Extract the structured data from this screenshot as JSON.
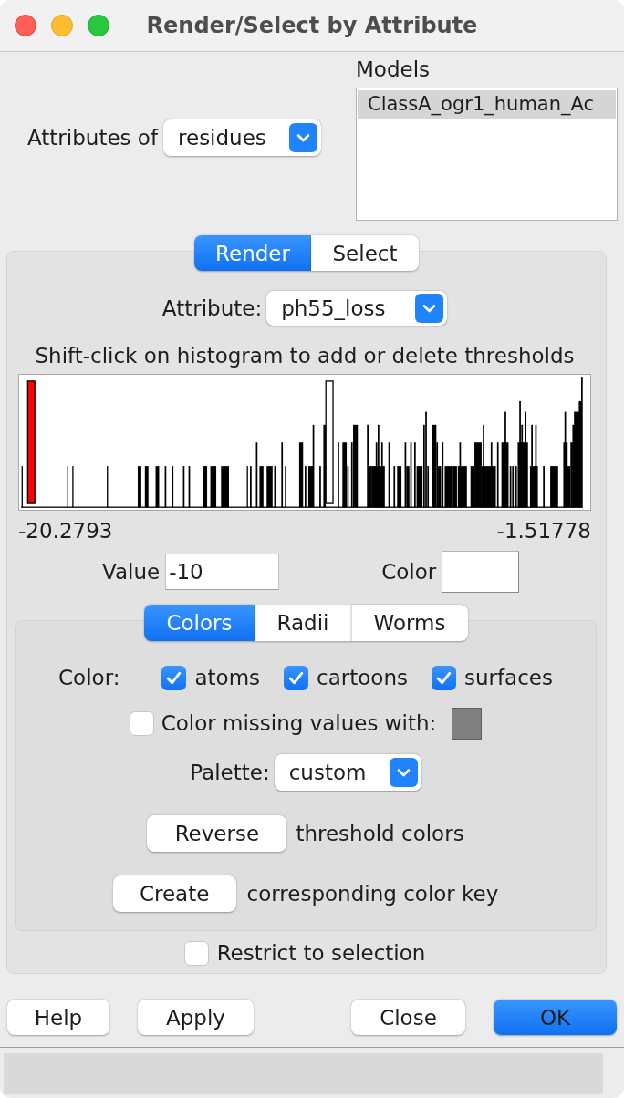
{
  "window": {
    "title": "Render/Select by Attribute"
  },
  "attributes_of": {
    "label": "Attributes of",
    "value": "residues"
  },
  "models": {
    "label": "Models",
    "items": [
      {
        "label": "ClassA_ogr1_human_Ac",
        "selected": true
      }
    ]
  },
  "mode_tabs": [
    {
      "label": "Render",
      "selected": true
    },
    {
      "label": "Select",
      "selected": false
    }
  ],
  "attribute": {
    "label": "Attribute:",
    "value": "ph55_loss"
  },
  "histogram": {
    "hint": "Shift-click on histogram to add or delete thresholds",
    "min_label": "-20.2793",
    "max_label": "-1.51778",
    "thresholds": [
      {
        "color": "#ff0000",
        "level": 0.018
      },
      {
        "color": "#ffffff",
        "level": 0.549
      }
    ]
  },
  "threshold": {
    "value_label": "Value",
    "value": "-10",
    "color_label": "Color",
    "color": "#ffffff"
  },
  "render_tabs": [
    {
      "label": "Colors",
      "selected": true
    },
    {
      "label": "Radii",
      "selected": false
    },
    {
      "label": "Worms",
      "selected": false
    }
  ],
  "colors": {
    "targets_label": "Color:",
    "targets": [
      {
        "label": "atoms",
        "checked": true
      },
      {
        "label": "cartoons",
        "checked": true
      },
      {
        "label": "surfaces",
        "checked": true
      }
    ],
    "missing": {
      "label": "Color missing values with:",
      "checked": false,
      "color": "#808080"
    },
    "palette": {
      "label": "Palette:",
      "value": "custom"
    },
    "reverse": {
      "button": "Reverse",
      "text": "threshold colors"
    },
    "color_key": {
      "button": "Create",
      "text": "corresponding color key"
    }
  },
  "restrict": {
    "label": "Restrict to selection",
    "checked": false
  },
  "buttons_left": [
    {
      "label": "Help",
      "default": false
    },
    {
      "label": "Apply",
      "default": false
    }
  ],
  "buttons_right": [
    {
      "label": "Close",
      "default": false
    },
    {
      "label": "OK",
      "default": true
    }
  ]
}
